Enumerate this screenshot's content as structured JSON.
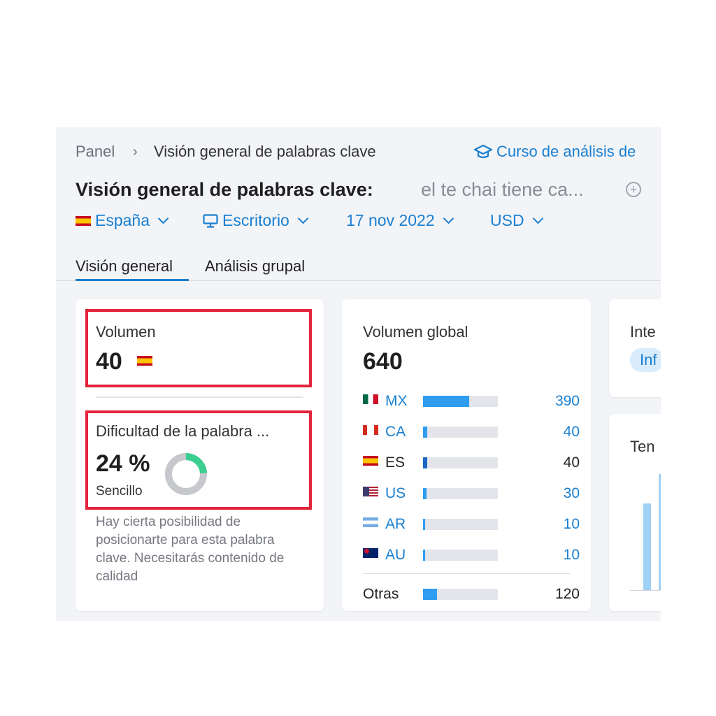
{
  "breadcrumb": {
    "root": "Panel",
    "current": "Visión general de palabras clave"
  },
  "course_link": "Curso de análisis de",
  "title": {
    "main": "Visión general de palabras clave:",
    "keyword": "el te chai tiene ca..."
  },
  "filters": {
    "country": "España",
    "device": "Escritorio",
    "date": "17 nov 2022",
    "currency": "USD"
  },
  "tabs": [
    {
      "label": "Visión general",
      "active": true
    },
    {
      "label": "Análisis grupal",
      "active": false
    }
  ],
  "volume": {
    "label": "Volumen",
    "value": "40"
  },
  "difficulty": {
    "label": "Dificultad de la palabra ...",
    "value": "24 %",
    "percent": 24,
    "level": "Sencillo",
    "description": "Hay cierta posibilidad de posicionarte para esta palabra clave. Necesitarás contenido de calidad"
  },
  "global_volume": {
    "label": "Volumen global",
    "value": "640",
    "countries": [
      {
        "code": "MX",
        "flag": "mexico-flag-icon",
        "value": "390",
        "fraction": 0.62,
        "link": true
      },
      {
        "code": "CA",
        "flag": "canada-flag-icon",
        "value": "40",
        "fraction": 0.06,
        "link": true
      },
      {
        "code": "ES",
        "flag": "spain-flag-icon",
        "value": "40",
        "fraction": 0.06,
        "link": false,
        "selected": true
      },
      {
        "code": "US",
        "flag": "usa-flag-icon",
        "value": "30",
        "fraction": 0.05,
        "link": true
      },
      {
        "code": "AR",
        "flag": "argentina-flag-icon",
        "value": "10",
        "fraction": 0.03,
        "link": true
      },
      {
        "code": "AU",
        "flag": "australia-flag-icon",
        "value": "10",
        "fraction": 0.03,
        "link": true
      }
    ],
    "others": {
      "label": "Otras",
      "value": "120",
      "fraction": 0.19
    }
  },
  "intent": {
    "label": "Inte",
    "pill": "Inf"
  },
  "trend": {
    "label": "Ten",
    "bars": [
      0.75,
      1.0
    ]
  },
  "colors": {
    "accent": "#1a7fd1",
    "highlight": "#e4233c",
    "bar": "#2e9df0",
    "donut": "#3ccf91"
  }
}
